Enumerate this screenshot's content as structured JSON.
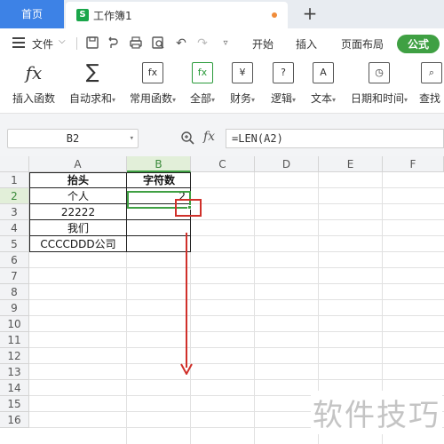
{
  "tabbar": {
    "home_label": "首页",
    "doc_icon_letter": "S",
    "doc_title": "工作簿1",
    "add_tab_label": "+"
  },
  "menu": {
    "file_label": "文件",
    "quick_access": [
      "save-icon",
      "export-icon",
      "print-icon",
      "preview-icon",
      "undo-icon",
      "redo-icon",
      "more-icon"
    ],
    "tabs": [
      {
        "label": "开始",
        "active": false
      },
      {
        "label": "插入",
        "active": false
      },
      {
        "label": "页面布局",
        "active": false
      },
      {
        "label": "公式",
        "active": true
      }
    ]
  },
  "ribbon": {
    "tools": [
      {
        "label": "插入函数",
        "icon": "fx-icon",
        "dropdown": false
      },
      {
        "label": "自动求和",
        "icon": "sum-icon",
        "dropdown": true
      },
      {
        "label": "常用函数",
        "icon": "function-star-icon",
        "dropdown": true
      },
      {
        "label": "全部",
        "icon": "all-functions-icon",
        "dropdown": true
      },
      {
        "label": "财务",
        "icon": "finance-icon",
        "dropdown": true
      },
      {
        "label": "逻辑",
        "icon": "logic-icon",
        "dropdown": true
      },
      {
        "label": "文本",
        "icon": "text-icon",
        "dropdown": true
      },
      {
        "label": "日期和时间",
        "icon": "datetime-icon",
        "dropdown": true
      },
      {
        "label": "查找",
        "icon": "lookup-icon",
        "dropdown": false
      }
    ]
  },
  "formula_bar": {
    "name_box": "B2",
    "fx_label": "fx",
    "formula": "=LEN(A2)"
  },
  "grid": {
    "columns": [
      "A",
      "B",
      "C",
      "D",
      "E",
      "F"
    ],
    "selected_column": "B",
    "rows": [
      "1",
      "2",
      "3",
      "4",
      "5",
      "6",
      "7",
      "8",
      "9",
      "10",
      "11",
      "12",
      "13",
      "14",
      "15",
      "16"
    ],
    "selected_row": "2",
    "cells": {
      "A1": "抬头",
      "B1": "字符数",
      "A2": "个人",
      "B2": "2",
      "A3": "22222",
      "A4": "我们",
      "A5": "CCCCDDD公司"
    }
  },
  "watermark": "软件技巧",
  "colors": {
    "accent_green": "#3fa043",
    "home_tab_blue": "#3d82e6",
    "annotation_red": "#d0302a"
  }
}
